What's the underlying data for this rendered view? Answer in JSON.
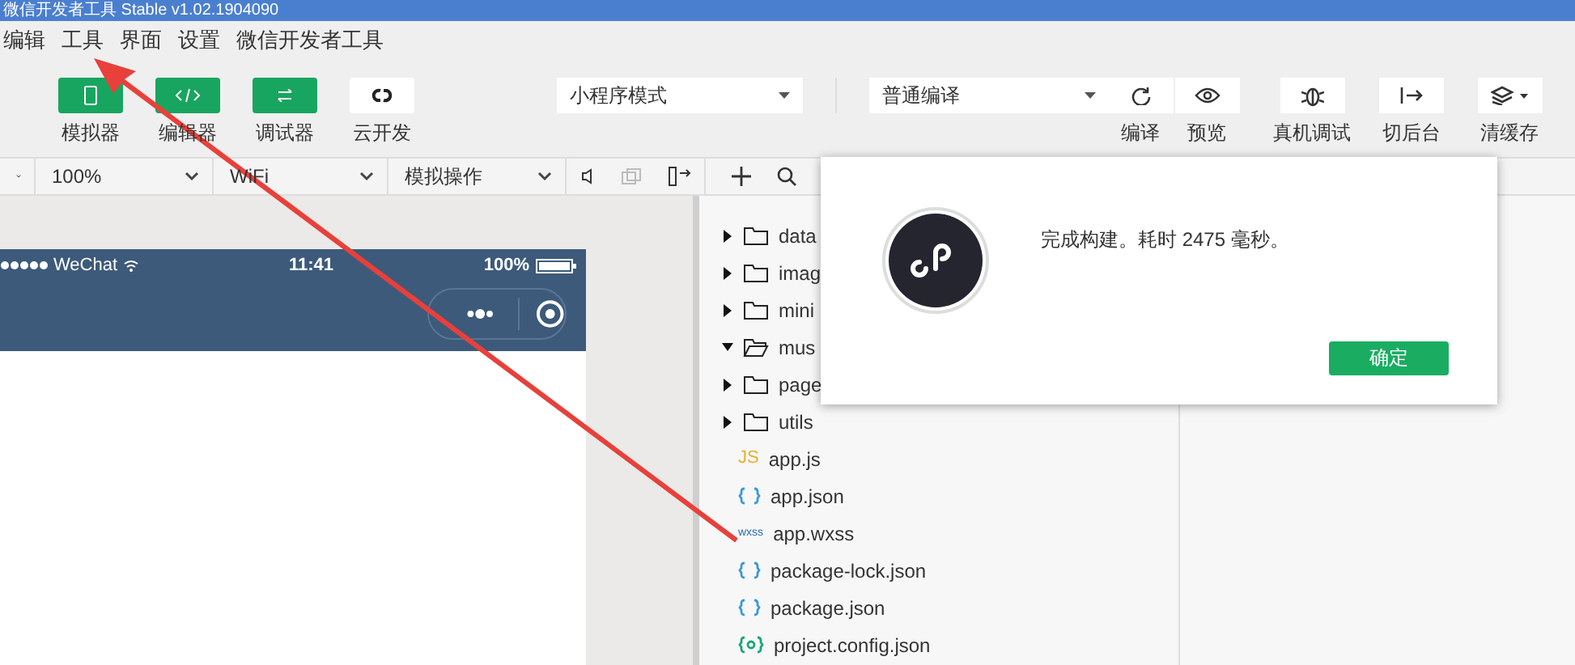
{
  "window": {
    "title": "微信开发者工具 Stable v1.02.1904090"
  },
  "menu": [
    "编辑",
    "工具",
    "界面",
    "设置",
    "微信开发者工具"
  ],
  "toolbar": {
    "modes": [
      {
        "label": "模拟器",
        "kind": "phone",
        "on": true
      },
      {
        "label": "编辑器",
        "kind": "code",
        "on": true
      },
      {
        "label": "调试器",
        "kind": "debug",
        "on": true
      },
      {
        "label": "云开发",
        "kind": "cloud",
        "on": false
      }
    ],
    "mode_select": "小程序模式",
    "compile_select": "普通编译",
    "actions": [
      {
        "label": "编译",
        "kind": "refresh"
      },
      {
        "label": "预览",
        "kind": "eye"
      },
      {
        "label": "真机调试",
        "kind": "bug"
      },
      {
        "label": "切后台",
        "kind": "background"
      },
      {
        "label": "清缓存",
        "kind": "layers"
      }
    ]
  },
  "sim_toolbar": {
    "zoom": "100%",
    "network": "WiFi",
    "operation": "模拟操作"
  },
  "phone": {
    "carrier": "WeChat",
    "time": "11:41",
    "battery": "100%"
  },
  "tree": [
    {
      "name": "data",
      "kind": "folder",
      "expanded": false
    },
    {
      "name": "imag",
      "kind": "folder",
      "expanded": false
    },
    {
      "name": "mini",
      "kind": "folder",
      "expanded": false
    },
    {
      "name": "mus",
      "kind": "folder",
      "expanded": true
    },
    {
      "name": "page",
      "kind": "folder",
      "expanded": false
    },
    {
      "name": "utils",
      "kind": "folder",
      "expanded": false
    },
    {
      "name": "app.js",
      "kind": "js",
      "badge": "JS"
    },
    {
      "name": "app.json",
      "kind": "json"
    },
    {
      "name": "app.wxss",
      "kind": "wxss",
      "badge": "wxss"
    },
    {
      "name": "package-lock.json",
      "kind": "json"
    },
    {
      "name": "package.json",
      "kind": "json"
    },
    {
      "name": "project.config.json",
      "kind": "config"
    }
  ],
  "dialog": {
    "message": "完成构建。耗时 2475 毫秒。",
    "button": "确定"
  }
}
